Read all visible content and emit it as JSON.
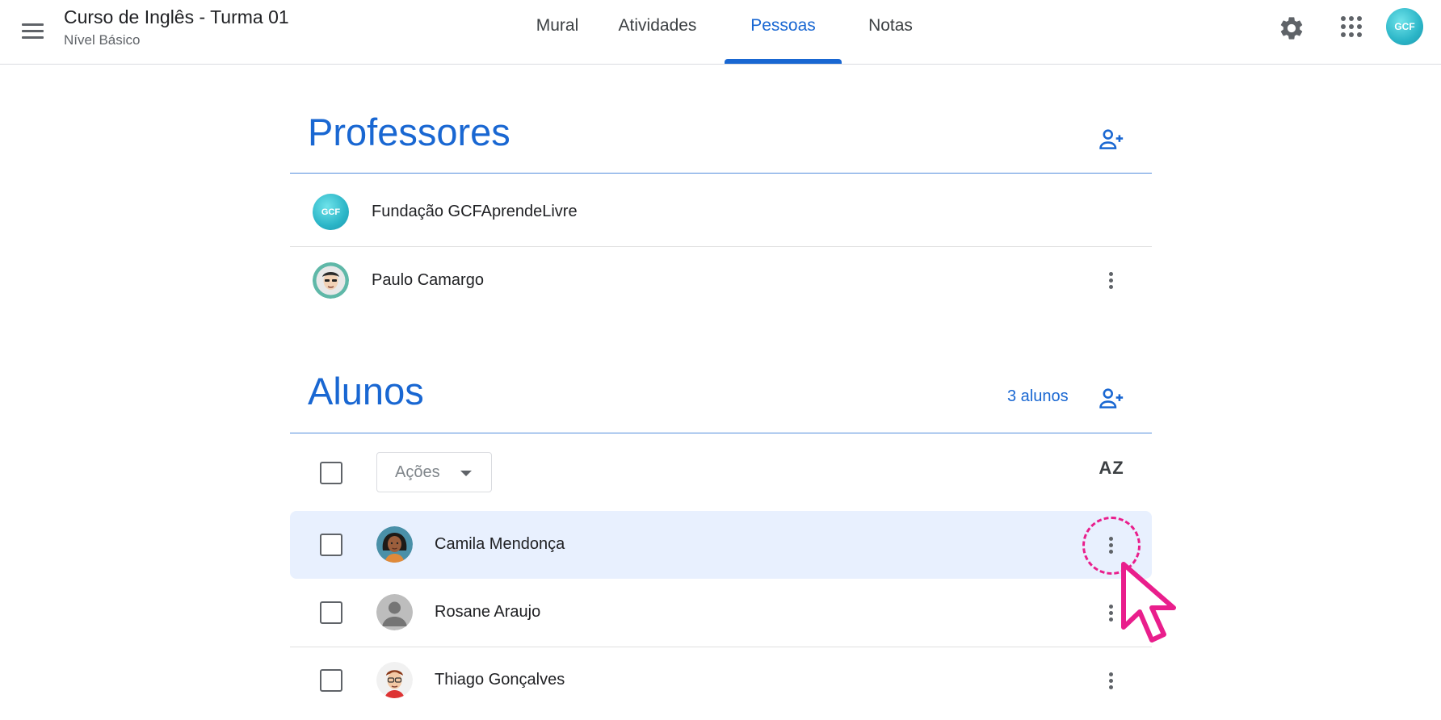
{
  "header": {
    "class_title": "Curso de Inglês - Turma 01",
    "class_subtitle": "Nível Básico",
    "tabs": [
      {
        "label": "Mural",
        "active": false
      },
      {
        "label": "Atividades",
        "active": false
      },
      {
        "label": "Pessoas",
        "active": true
      },
      {
        "label": "Notas",
        "active": false
      }
    ],
    "avatar_label": "GCF",
    "icons": [
      "menu-icon",
      "gear-icon",
      "apps-grid-icon"
    ]
  },
  "teachers": {
    "title": "Professores",
    "people": [
      {
        "name": "Fundação GCFAprendeLivre",
        "avatar_text": "GCF"
      },
      {
        "name": "Paulo Camargo"
      }
    ]
  },
  "students": {
    "title": "Alunos",
    "count_label": "3 alunos",
    "actions_label": "Ações",
    "sort_label": "AZ",
    "people": [
      {
        "name": "Camila Mendonça",
        "highlighted": true
      },
      {
        "name": "Rosane Araujo"
      },
      {
        "name": "Thiago Gonçalves"
      }
    ]
  },
  "colors": {
    "accent": "#1967d2",
    "row_highlight": "#e8f0fe",
    "pointer_annotation": "#e91e8c"
  }
}
